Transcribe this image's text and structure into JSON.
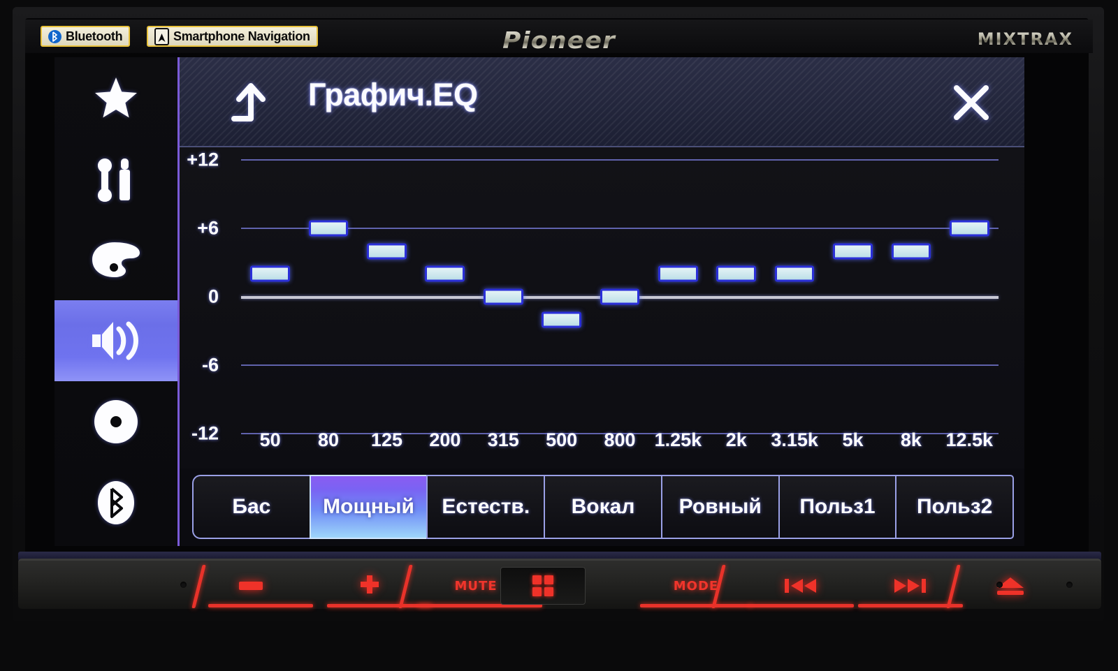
{
  "device": {
    "brand": "Pioneer",
    "feature_badge": "MIXTRAX"
  },
  "status_badges": [
    {
      "label": "Bluetooth",
      "icon": "bluetooth-icon"
    },
    {
      "label": "Smartphone Navigation",
      "icon": "navigation-arrow-icon"
    }
  ],
  "sidebar": {
    "items": [
      {
        "name": "favorites",
        "icon": "star-icon",
        "selected": false
      },
      {
        "name": "settings",
        "icon": "wrench-screwdriver-icon",
        "selected": false
      },
      {
        "name": "theme",
        "icon": "palette-icon",
        "selected": false
      },
      {
        "name": "audio",
        "icon": "speaker-icon",
        "selected": true
      },
      {
        "name": "disc",
        "icon": "disc-icon",
        "selected": false
      },
      {
        "name": "bluetooth",
        "icon": "bluetooth-icon",
        "selected": false
      }
    ]
  },
  "header": {
    "title": "Графич.EQ",
    "back_icon": "back-arrow-icon",
    "close_icon": "close-icon"
  },
  "chart_data": {
    "type": "bar",
    "title": "Графич.EQ",
    "xlabel": "",
    "ylabel": "",
    "categories": [
      "50",
      "80",
      "125",
      "200",
      "315",
      "500",
      "800",
      "1.25k",
      "2k",
      "3.15k",
      "5k",
      "8k",
      "12.5k"
    ],
    "values": [
      2,
      6,
      4,
      2,
      0,
      -2,
      0,
      2,
      2,
      2,
      4,
      4,
      6
    ],
    "ylim": [
      -12,
      12
    ],
    "yticks": [
      "+12",
      "+6",
      "0",
      "-6",
      "-12"
    ],
    "ytick_values": [
      12,
      6,
      0,
      -6,
      -12
    ],
    "grid": true,
    "legend": "none",
    "units": "dB",
    "bar_color": "#cfe8ee",
    "bar_border_color": "#2a2fd8"
  },
  "presets": {
    "selected": "Мощный",
    "items": [
      {
        "label": "Бас",
        "active": false
      },
      {
        "label": "Мощный",
        "active": true
      },
      {
        "label": "Естеств.",
        "active": false
      },
      {
        "label": "Вокал",
        "active": false
      },
      {
        "label": "Ровный",
        "active": false
      },
      {
        "label": "Польз1",
        "active": false
      },
      {
        "label": "Польз2",
        "active": false
      }
    ]
  },
  "hardware_buttons": [
    {
      "name": "volume-down",
      "glyph": "minus",
      "label": ""
    },
    {
      "name": "volume-up",
      "glyph": "plus",
      "label": ""
    },
    {
      "name": "mute",
      "glyph": "text",
      "label": "MUTE"
    },
    {
      "name": "home",
      "glyph": "grid",
      "label": ""
    },
    {
      "name": "mode",
      "glyph": "text",
      "label": "MODE"
    },
    {
      "name": "previous-track",
      "glyph": "prev",
      "label": ""
    },
    {
      "name": "next-track",
      "glyph": "next",
      "label": ""
    },
    {
      "name": "eject",
      "glyph": "eject",
      "label": ""
    }
  ],
  "colors": {
    "accent_purple": "#7a5bd8",
    "selected_blue": "#8286f3",
    "bar_fill": "#cfe8ee",
    "grid_line": "#6f72c8",
    "hw_red": "#ef3229",
    "badge_border": "#e8c23c"
  }
}
